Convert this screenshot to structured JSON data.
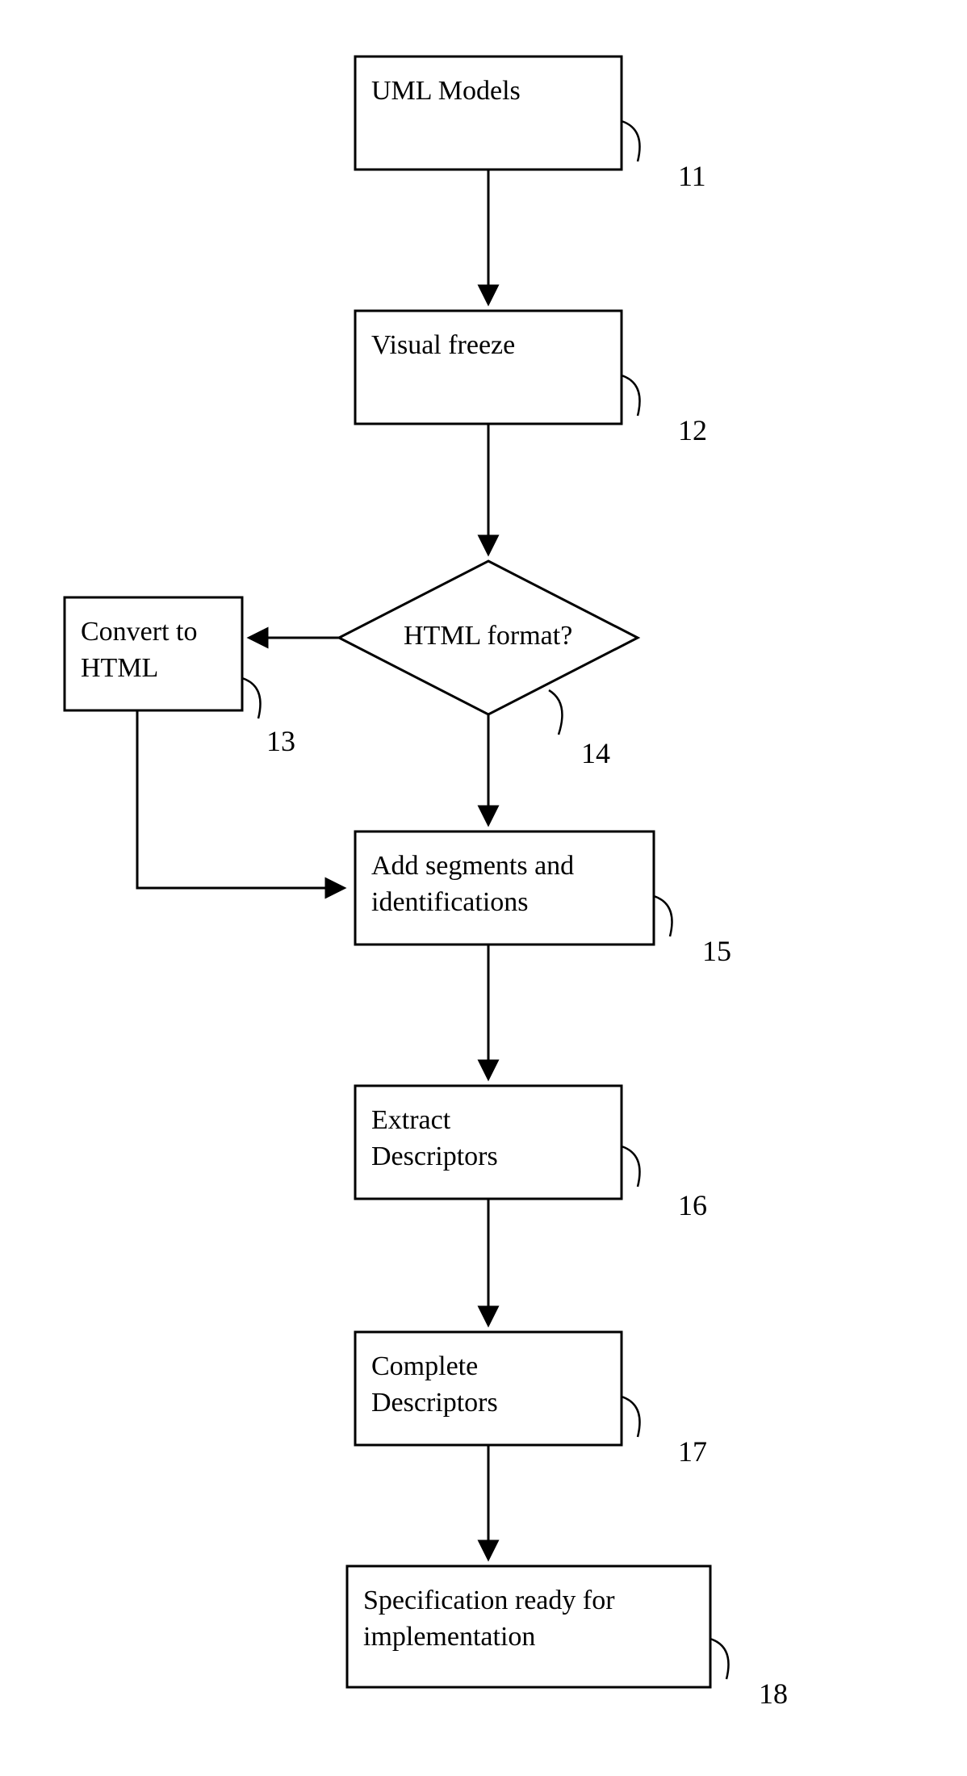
{
  "diagram": {
    "nodes": {
      "n11": {
        "label": "UML Models",
        "ref": "11"
      },
      "n12": {
        "label": "Visual freeze",
        "ref": "12"
      },
      "n13": {
        "line1": "Convert to",
        "line2": "HTML",
        "ref": "13"
      },
      "n14": {
        "label": "HTML format?",
        "ref": "14"
      },
      "n15": {
        "line1": "Add segments and",
        "line2": "identifications",
        "ref": "15"
      },
      "n16": {
        "line1": "Extract",
        "line2": "Descriptors",
        "ref": "16"
      },
      "n17": {
        "line1": "Complete",
        "line2": "Descriptors",
        "ref": "17"
      },
      "n18": {
        "line1": "Specification ready for",
        "line2": "implementation",
        "ref": "18"
      }
    }
  }
}
